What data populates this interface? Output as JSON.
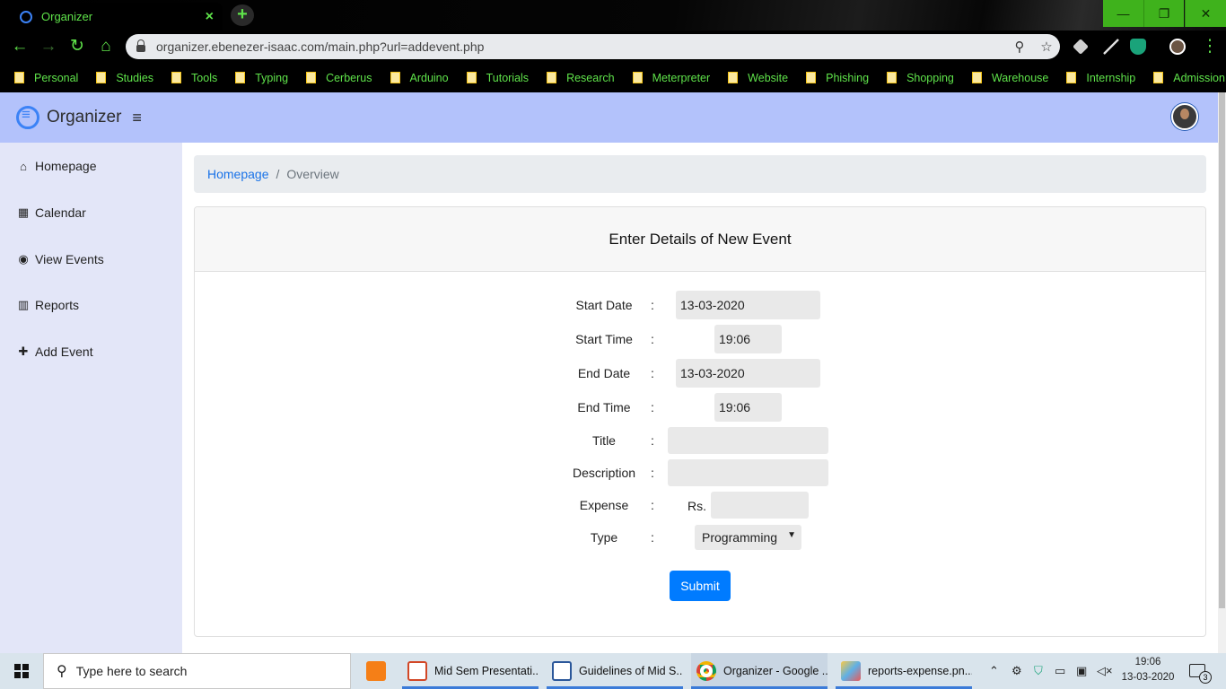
{
  "browser": {
    "tab_title": "Organizer",
    "tab_close": "×",
    "new_tab": "+",
    "url": "organizer.ebenezer-isaac.com/main.php?url=addevent.php",
    "window_min": "—",
    "window_restore": "❐",
    "window_close": "✕",
    "accent": "#5fe34a",
    "bookmarks": [
      "Personal",
      "Studies",
      "Tools",
      "Typing",
      "Cerberus",
      "Arduino",
      "Tutorials",
      "Research",
      "Meterpreter",
      "Website",
      "Phishing",
      "Shopping",
      "Warehouse",
      "Internship",
      "Admission"
    ]
  },
  "app": {
    "brand": "Organizer",
    "header_color": "#b3c2fb",
    "sidebar": [
      {
        "label": "Homepage",
        "icon": "home-icon",
        "glyph": "⌂"
      },
      {
        "label": "Calendar",
        "icon": "calendar-icon",
        "glyph": "▦"
      },
      {
        "label": "View Events",
        "icon": "eye-icon",
        "glyph": "◉"
      },
      {
        "label": "Reports",
        "icon": "bar-chart-icon",
        "glyph": "▥"
      },
      {
        "label": "Add Event",
        "icon": "plus-icon",
        "glyph": "✚"
      }
    ],
    "breadcrumb": {
      "home": "Homepage",
      "sep": "/",
      "current": "Overview"
    },
    "form": {
      "title": "Enter Details of New Event",
      "colon": ":",
      "start_date_label": "Start Date",
      "start_date": "13-03-2020",
      "start_time_label": "Start Time",
      "start_time": "19:06",
      "end_date_label": "End Date",
      "end_date": "13-03-2020",
      "end_time_label": "End Time",
      "end_time": "19:06",
      "title_label": "Title",
      "title_value": "",
      "description_label": "Description",
      "description_value": "",
      "expense_label": "Expense",
      "currency": "Rs.",
      "expense_value": "",
      "type_label": "Type",
      "type_value": "Programming",
      "submit": "Submit"
    }
  },
  "taskbar": {
    "search_placeholder": "Type here to search",
    "apps": [
      {
        "label": "Mid Sem Presentati..."
      },
      {
        "label": "Guidelines of Mid S..."
      },
      {
        "label": "Organizer - Google ..."
      },
      {
        "label": "reports-expense.pn..."
      }
    ],
    "time": "19:06",
    "date": "13-03-2020",
    "notifications": "3"
  }
}
